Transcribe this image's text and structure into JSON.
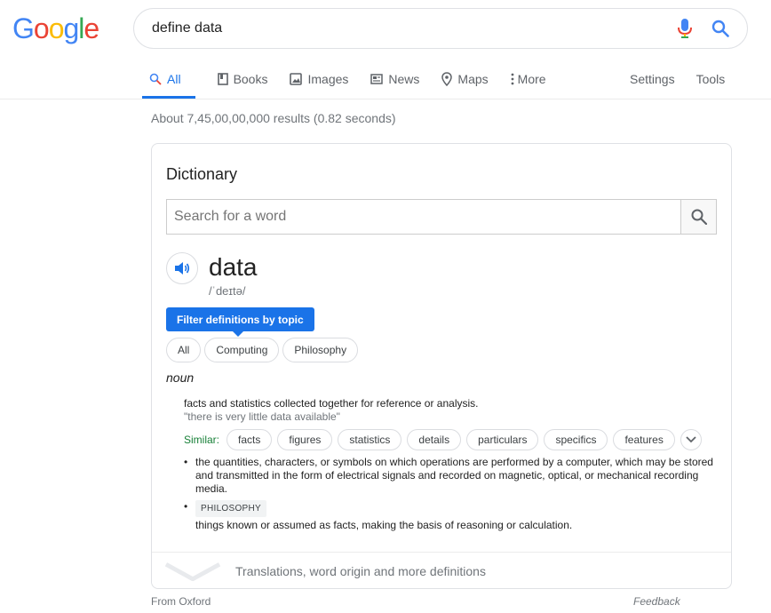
{
  "logo": {
    "text": "Google",
    "colors": [
      "#4285F4",
      "#EA4335",
      "#FBBC05",
      "#4285F4",
      "#34A853",
      "#EA4335"
    ]
  },
  "search": {
    "query": "define data",
    "mic_icon": "mic-icon",
    "search_icon": "search-icon"
  },
  "tabs": [
    {
      "label": "All",
      "icon": "search-icon",
      "active": true
    },
    {
      "label": "Books",
      "icon": "book-icon"
    },
    {
      "label": "Images",
      "icon": "image-icon"
    },
    {
      "label": "News",
      "icon": "news-icon"
    },
    {
      "label": "Maps",
      "icon": "map-pin-icon"
    },
    {
      "label": "More",
      "icon": "more-vert-icon"
    }
  ],
  "tabs_right": {
    "settings": "Settings",
    "tools": "Tools"
  },
  "result_stats": "About 7,45,00,00,000 results (0.82 seconds)",
  "dictionary": {
    "title": "Dictionary",
    "search_placeholder": "Search for a word",
    "word": "data",
    "phonetic": "/ˈdeɪtə/",
    "filter_tip": "Filter definitions by topic",
    "topics": [
      "All",
      "Computing",
      "Philosophy"
    ],
    "part_of_speech": "noun",
    "definition": "facts and statistics collected together for reference or analysis.",
    "example": "\"there is very little data available\"",
    "similar_label": "Similar:",
    "synonyms": [
      "facts",
      "figures",
      "statistics",
      "details",
      "particulars",
      "specifics",
      "features"
    ],
    "sub_definitions": [
      {
        "tag": "",
        "text": "the quantities, characters, or symbols on which operations are performed by a computer, which may be stored and transmitted in the form of electrical signals and recorded on magnetic, optical, or mechanical recording media."
      },
      {
        "tag": "PHILOSOPHY",
        "text": "things known or assumed as facts, making the basis of reasoning or calculation."
      }
    ],
    "more_link": "Translations, word origin and more definitions"
  },
  "footer": {
    "source": "From Oxford",
    "feedback": "Feedback"
  },
  "colors": {
    "accent": "#1a73e8",
    "similar_label": "#188038",
    "muted": "#70757a"
  }
}
